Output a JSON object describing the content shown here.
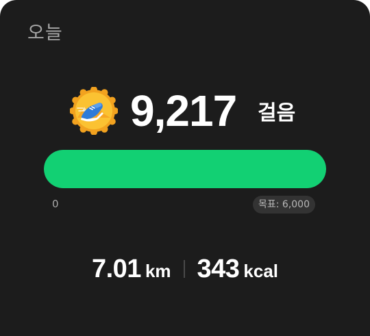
{
  "card": {
    "title": "오늘"
  },
  "steps": {
    "count": "9,217",
    "unit": "걸음",
    "badge_icon": "running-shoe-medal-icon",
    "progress_fraction": 1.0,
    "scale_min": "0",
    "goal_label": "목표: 6,000"
  },
  "stats": {
    "distance_value": "7.01",
    "distance_unit": "km",
    "calories_value": "343",
    "calories_unit": "kcal"
  },
  "colors": {
    "background": "#1c1c1c",
    "progress": "#12d073",
    "badge_gold": "#f5a623"
  }
}
